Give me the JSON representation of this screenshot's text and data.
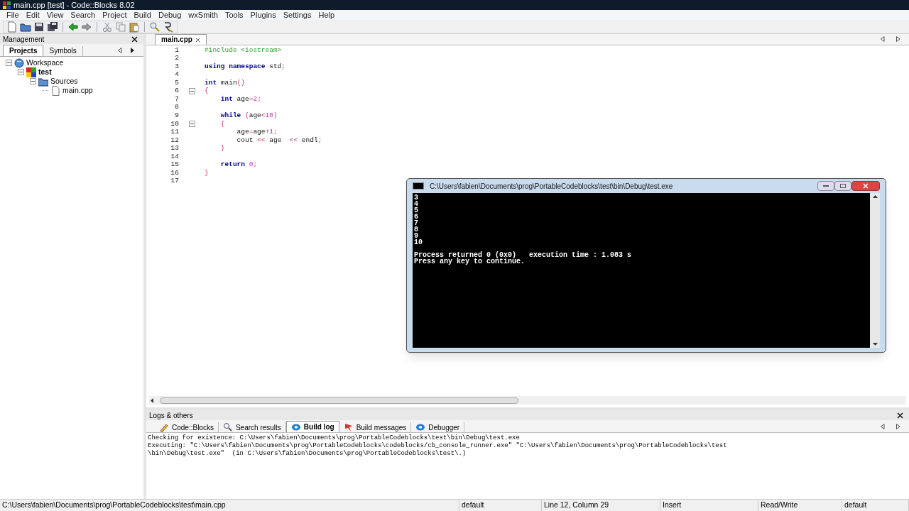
{
  "window": {
    "title": "main.cpp [test] - Code::Blocks 8.02"
  },
  "menu": [
    "File",
    "Edit",
    "View",
    "Search",
    "Project",
    "Build",
    "Debug",
    "wxSmith",
    "Tools",
    "Plugins",
    "Settings",
    "Help"
  ],
  "toolbar": [
    {
      "kind": "new"
    },
    {
      "kind": "open"
    },
    {
      "kind": "save"
    },
    {
      "kind": "saveall"
    },
    {
      "kind": "sep"
    },
    {
      "kind": "undo"
    },
    {
      "kind": "redo"
    },
    {
      "kind": "sep"
    },
    {
      "kind": "cut"
    },
    {
      "kind": "copy"
    },
    {
      "kind": "paste"
    },
    {
      "kind": "sep"
    },
    {
      "kind": "find"
    },
    {
      "kind": "replace"
    }
  ],
  "management": {
    "title": "Management",
    "tabs": [
      {
        "label": "Projects",
        "selected": true
      },
      {
        "label": "Symbols",
        "selected": false
      }
    ],
    "tree": [
      {
        "label": "Workspace",
        "kind": "workspace",
        "bold": false,
        "children": [
          {
            "label": "test",
            "kind": "project",
            "bold": true,
            "children": [
              {
                "label": "Sources",
                "kind": "folder",
                "bold": false,
                "children": [
                  {
                    "label": "main.cpp",
                    "kind": "file",
                    "bold": false
                  }
                ]
              }
            ]
          }
        ]
      }
    ]
  },
  "editor": {
    "tabs": [
      {
        "label": "main.cpp",
        "selected": true
      }
    ],
    "lines": [
      {
        "number": "1",
        "segments": [
          {
            "t": "#include <iostream>",
            "kind": "preproc"
          }
        ]
      },
      {
        "number": "2"
      },
      {
        "number": "3",
        "segments": [
          {
            "t": "using namespace",
            "kind": "keyword"
          },
          {
            "t": " std",
            "kind": "plain"
          },
          {
            "t": ";",
            "kind": "op"
          }
        ]
      },
      {
        "number": "4"
      },
      {
        "number": "5",
        "segments": [
          {
            "t": "int",
            "kind": "keyword"
          },
          {
            "t": " main",
            "kind": "plain"
          },
          {
            "t": "()",
            "kind": "op"
          }
        ]
      },
      {
        "number": "6",
        "fold": true,
        "segments": [
          {
            "t": "{",
            "kind": "op"
          }
        ]
      },
      {
        "number": "7",
        "segments": [
          {
            "t": "    int",
            "kind": "keyword"
          },
          {
            "t": " age",
            "kind": "plain"
          },
          {
            "t": "=",
            "kind": "op"
          },
          {
            "t": "2",
            "kind": "number"
          },
          {
            "t": ";",
            "kind": "op"
          }
        ]
      },
      {
        "number": "8"
      },
      {
        "number": "9",
        "segments": [
          {
            "t": "    while",
            "kind": "keyword"
          },
          {
            "t": " (",
            "kind": "op"
          },
          {
            "t": "age",
            "kind": "plain"
          },
          {
            "t": "<",
            "kind": "op"
          },
          {
            "t": "10",
            "kind": "number"
          },
          {
            "t": ")",
            "kind": "op"
          }
        ]
      },
      {
        "number": "10",
        "fold": true,
        "segments": [
          {
            "t": "    {",
            "kind": "op"
          }
        ]
      },
      {
        "number": "11",
        "segments": [
          {
            "t": "        age",
            "kind": "plain"
          },
          {
            "t": "=",
            "kind": "op"
          },
          {
            "t": "age",
            "kind": "plain"
          },
          {
            "t": "+",
            "kind": "op"
          },
          {
            "t": "1",
            "kind": "number"
          },
          {
            "t": ";",
            "kind": "op"
          }
        ]
      },
      {
        "number": "12",
        "segments": [
          {
            "t": "        cout ",
            "kind": "plain"
          },
          {
            "t": "<<",
            "kind": "op"
          },
          {
            "t": " age  ",
            "kind": "plain"
          },
          {
            "t": "<<",
            "kind": "op"
          },
          {
            "t": " endl",
            "kind": "plain"
          },
          {
            "t": ";",
            "kind": "op"
          }
        ]
      },
      {
        "number": "13",
        "segments": [
          {
            "t": "    }",
            "kind": "op"
          }
        ]
      },
      {
        "number": "14"
      },
      {
        "number": "15",
        "segments": [
          {
            "t": "    return",
            "kind": "keyword"
          },
          {
            "t": " 0",
            "kind": "number"
          },
          {
            "t": ";",
            "kind": "op"
          }
        ]
      },
      {
        "number": "16",
        "segments": [
          {
            "t": "}",
            "kind": "op"
          }
        ]
      },
      {
        "number": "17"
      }
    ]
  },
  "console": {
    "title": "C:\\Users\\fabien\\Documents\\prog\\PortableCodeblocks\\test\\bin\\Debug\\test.exe",
    "output": [
      "3",
      "4",
      "5",
      "6",
      "7",
      "8",
      "9",
      "10",
      "Process returned 0 (0x0)   execution time : 1.083 s",
      "Press any key to continue."
    ]
  },
  "logs": {
    "title": "Logs & others",
    "tabs": [
      {
        "label": "Code::Blocks",
        "selected": false
      },
      {
        "label": "Search results",
        "selected": false
      },
      {
        "label": "Build log",
        "selected": true
      },
      {
        "label": "Build messages",
        "selected": false
      },
      {
        "label": "Debugger",
        "selected": false
      }
    ],
    "text": [
      "Checking for existence: C:\\Users\\fabien\\Documents\\prog\\PortableCodeblocks\\test\\bin\\Debug\\test.exe",
      "Executing: \"C:\\Users\\fabien\\Documents\\prog\\PortableCodeblocks\\codeblocks/cb_console_runner.exe\" \"C:\\Users\\fabien\\Documents\\prog\\PortableCodeblocks\\test",
      "\\bin\\Debug\\test.exe\"  (in C:\\Users\\fabien\\Documents\\prog\\PortableCodeblocks\\test\\.)"
    ]
  },
  "status_bar": [
    "C:\\Users\\fabien\\Documents\\prog\\PortableCodeblocks\\test\\main.cpp",
    "default",
    "Line 12, Column 29",
    "Insert",
    "Read/Write",
    "default"
  ]
}
